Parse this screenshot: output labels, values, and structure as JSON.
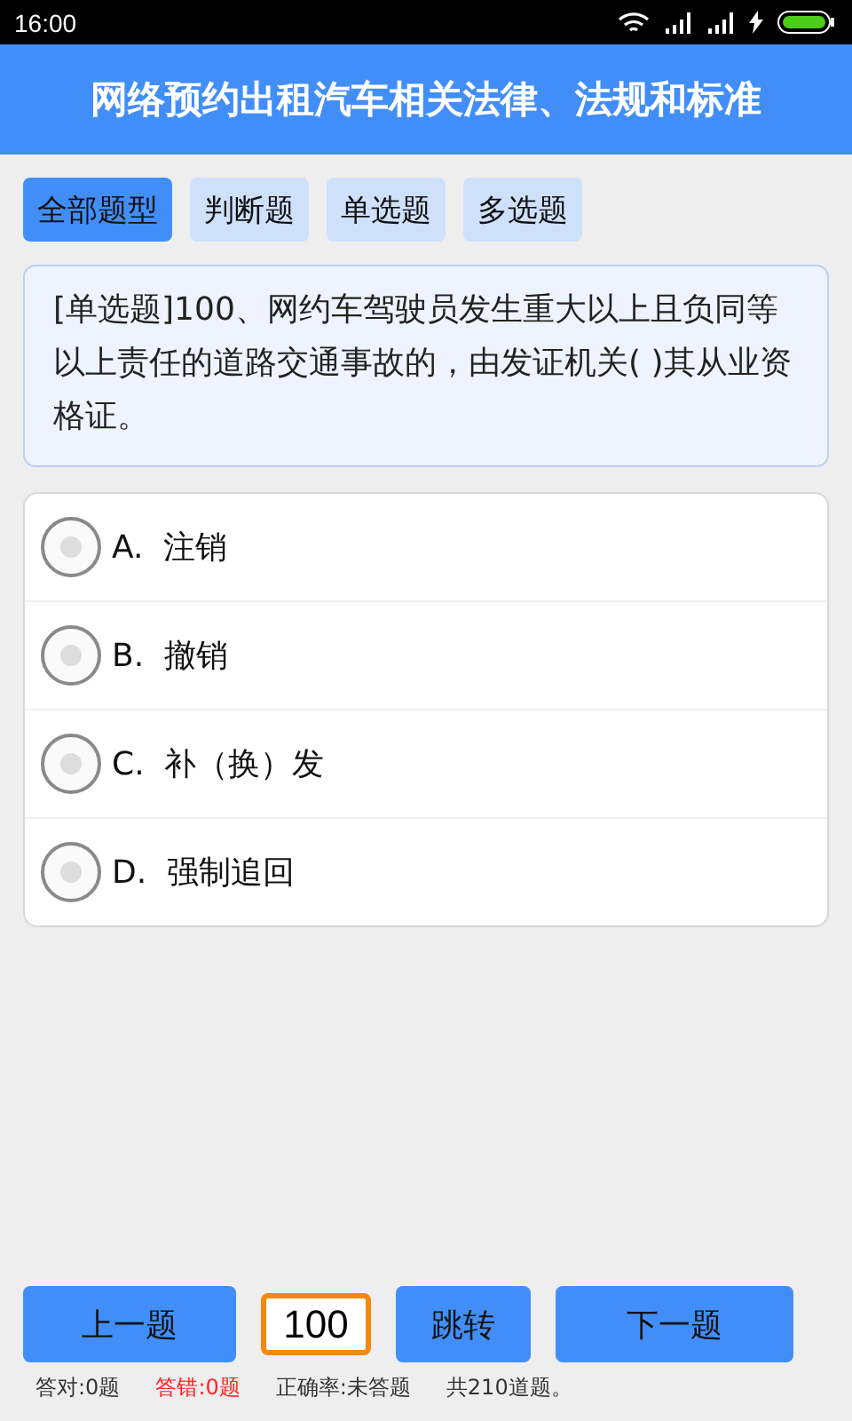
{
  "status_bar": {
    "time": "16:00"
  },
  "header": {
    "title": "网络预约出租汽车相关法律、法规和标准"
  },
  "filters": [
    {
      "label": "全部题型",
      "selected": true
    },
    {
      "label": "判断题",
      "selected": false
    },
    {
      "label": "单选题",
      "selected": false
    },
    {
      "label": "多选题",
      "selected": false
    }
  ],
  "question": {
    "text": "[单选题]100、网约车驾驶员发生重大以上且负同等以上责任的道路交通事故的，由发证机关( )其从业资格证。"
  },
  "options": [
    {
      "letter": "A.",
      "text": "注销",
      "selected": false
    },
    {
      "letter": "B.",
      "text": "撤销",
      "selected": false
    },
    {
      "letter": "C.",
      "text": "补（换）发",
      "selected": false
    },
    {
      "letter": "D.",
      "text": "强制追回",
      "selected": false
    }
  ],
  "nav": {
    "prev": "上一题",
    "jump_value": "100",
    "jump": "跳转",
    "next": "下一题"
  },
  "stats": [
    {
      "text": "答对:0题",
      "kind": "normal"
    },
    {
      "text": "答错:0题",
      "kind": "wrong"
    },
    {
      "text": "正确率:未答题",
      "kind": "normal"
    },
    {
      "text": "共210道题。",
      "kind": "normal"
    }
  ]
}
